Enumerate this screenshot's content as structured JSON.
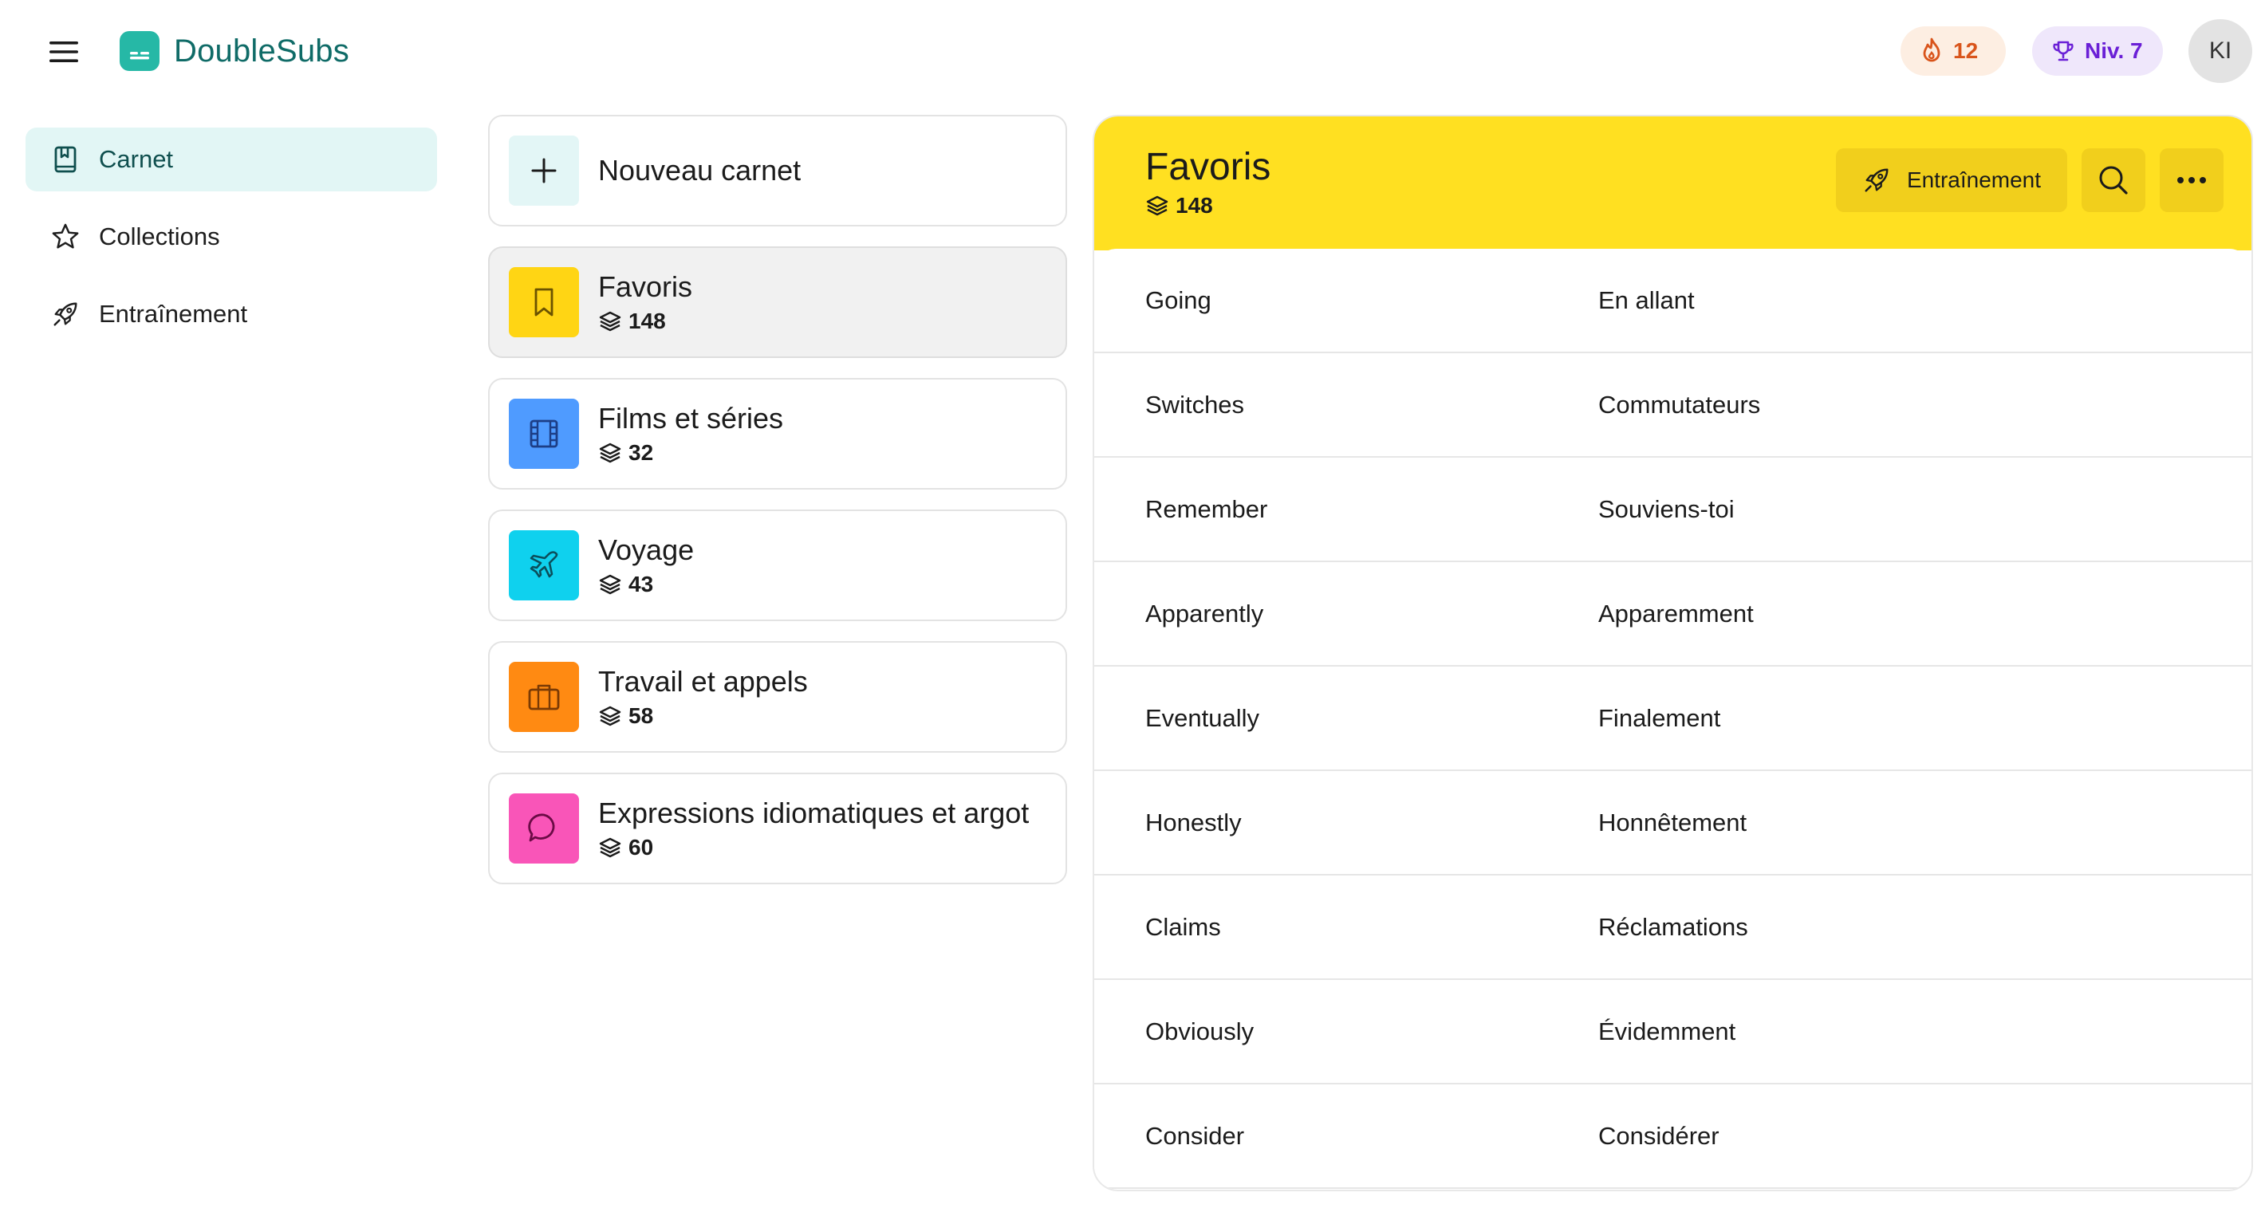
{
  "header": {
    "brand_name": "DoubleSubs",
    "streak_count": "12",
    "level_label": "Niv. 7",
    "avatar_initials": "KI",
    "colors": {
      "brand": "#26b8a6",
      "streak": "#d9541b",
      "level": "#6a1fd6"
    }
  },
  "sidebar": {
    "items": [
      {
        "label": "Carnet",
        "icon": "notebook-icon",
        "active": true
      },
      {
        "label": "Collections",
        "icon": "star-icon",
        "active": false
      },
      {
        "label": "Entraînement",
        "icon": "rocket-icon",
        "active": false
      }
    ]
  },
  "notebooks": {
    "new_label": "Nouveau carnet",
    "items": [
      {
        "title": "Favoris",
        "count": "148",
        "icon": "bookmark-icon",
        "color": "#ffd514",
        "selected": true
      },
      {
        "title": "Films et séries",
        "count": "32",
        "icon": "film-icon",
        "color": "#4f9bff",
        "selected": false
      },
      {
        "title": "Voyage",
        "count": "43",
        "icon": "plane-icon",
        "color": "#0fd1ee",
        "selected": false
      },
      {
        "title": "Travail et appels",
        "count": "58",
        "icon": "briefcase-icon",
        "color": "#ff8a12",
        "selected": false
      },
      {
        "title": "Expressions idiomatiques et argot",
        "count": "60",
        "icon": "chat-bubble-icon",
        "color": "#f955b8",
        "selected": false
      }
    ]
  },
  "detail": {
    "title": "Favoris",
    "count": "148",
    "train_label": "Entraînement",
    "header_color": "#ffe021",
    "words": [
      {
        "source": "Going",
        "translation": "En allant"
      },
      {
        "source": "Switches",
        "translation": "Commutateurs"
      },
      {
        "source": "Remember",
        "translation": "Souviens-toi"
      },
      {
        "source": "Apparently",
        "translation": "Apparemment"
      },
      {
        "source": "Eventually",
        "translation": "Finalement"
      },
      {
        "source": "Honestly",
        "translation": "Honnêtement"
      },
      {
        "source": "Claims",
        "translation": "Réclamations"
      },
      {
        "source": "Obviously",
        "translation": "Évidemment"
      },
      {
        "source": "Consider",
        "translation": "Considérer"
      }
    ]
  }
}
